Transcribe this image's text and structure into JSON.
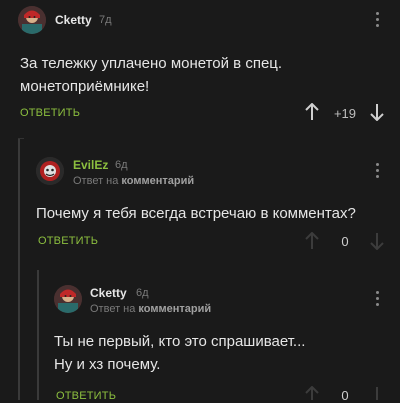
{
  "comments": [
    {
      "author": "Cketty",
      "time": "7д",
      "text_line1": "За тележку уплачено монетой в спец.",
      "text_line2": "монетоприёмнике!",
      "reply_label": "ОТВЕТИТЬ",
      "rating": "+19"
    },
    {
      "author": "EvilEz",
      "time": "6д",
      "reply_prefix": "Ответ на",
      "reply_link": "комментарий",
      "text_line1": "Почему я тебя всегда встречаю в комментах?",
      "reply_label": "ОТВЕТИТЬ",
      "rating": "0"
    },
    {
      "author": "Cketty",
      "time": "6д",
      "reply_prefix": "Ответ на",
      "reply_link": "комментарий",
      "text_line1": "Ты не первый, кто это спрашивает...",
      "text_line2": "Ну и хз почему.",
      "reply_label": "ОТВЕТИТЬ",
      "rating": "0"
    }
  ],
  "colors": {
    "background": "#1a1a1a",
    "accent_green": "#8cbf3f",
    "muted": "#7a7a7a",
    "text": "#e6e6e6"
  },
  "icons": {
    "upvote": "arrow-up-icon",
    "downvote": "arrow-down-icon",
    "menu": "more-vertical-icon"
  }
}
